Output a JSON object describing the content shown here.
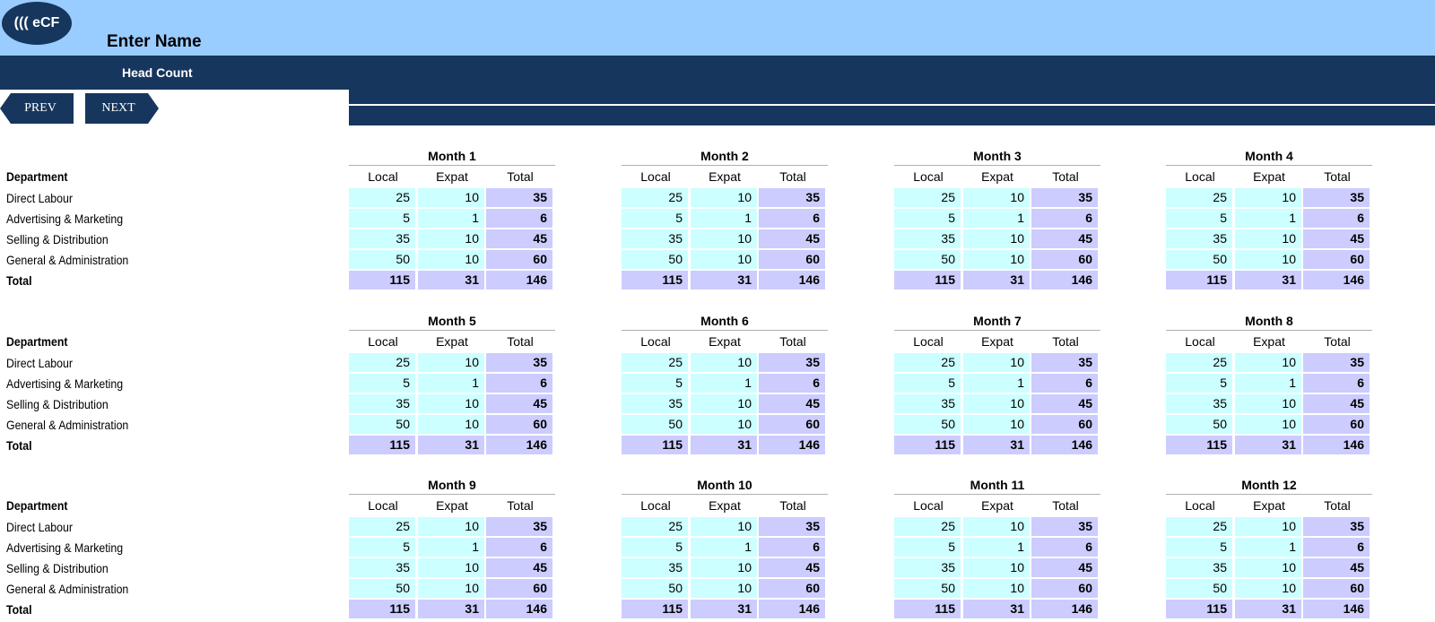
{
  "header": {
    "logo_text": "((( eCF",
    "company_name": "Enter Name",
    "sheet_title": "Head Count"
  },
  "nav": {
    "prev_label": "PREV",
    "next_label": "NEXT"
  },
  "table": {
    "department_header": "Department",
    "column_headers": [
      "Local",
      "Expat",
      "Total"
    ],
    "rows": [
      {
        "department": "Direct Labour",
        "local": 25,
        "expat": 10,
        "total": 35
      },
      {
        "department": "Advertising & Marketing",
        "local": 5,
        "expat": 1,
        "total": 6
      },
      {
        "department": "Selling & Distribution",
        "local": 35,
        "expat": 10,
        "total": 45
      },
      {
        "department": "General & Administration",
        "local": 50,
        "expat": 10,
        "total": 60
      }
    ],
    "total_row": {
      "label": "Total",
      "local": 115,
      "expat": 31,
      "total": 146
    }
  },
  "months": [
    "Month 1",
    "Month 2",
    "Month 3",
    "Month 4",
    "Month 5",
    "Month 6",
    "Month 7",
    "Month 8",
    "Month 9",
    "Month 10",
    "Month 11",
    "Month 12"
  ],
  "colors": {
    "header_light": "#99ccff",
    "header_dark": "#17365d",
    "input_cell": "#ccffff",
    "total_cell": "#ccccff"
  }
}
